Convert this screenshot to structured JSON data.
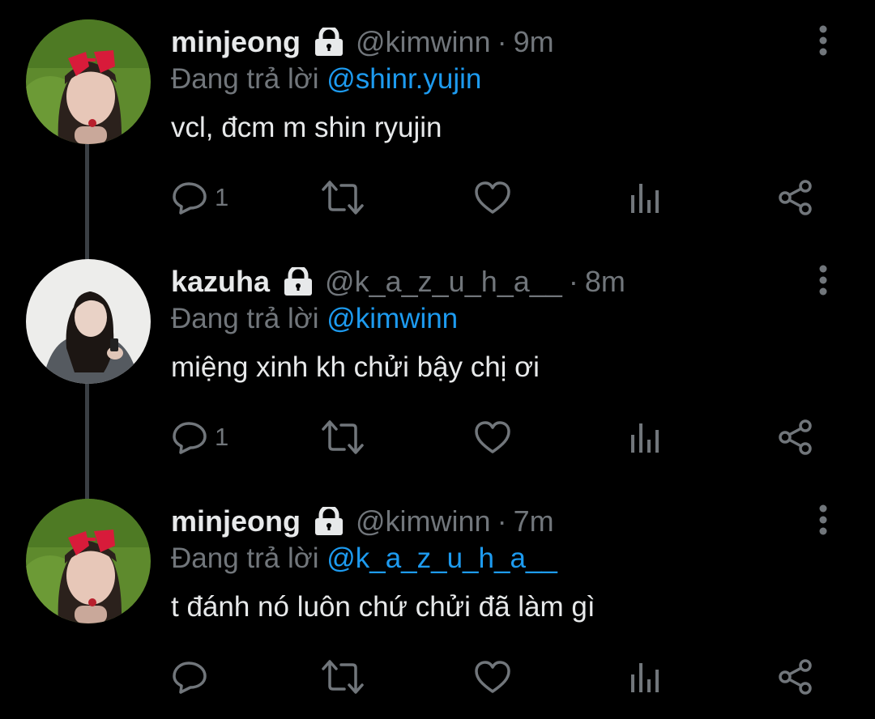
{
  "tweets": [
    {
      "name": "minjeong",
      "handle": "@kimwinn",
      "separator": "·",
      "time": "9m",
      "reply_prefix": "Đang trả lời",
      "reply_to": "@shinr.yujin",
      "text": "vcl, đcm m shin ryujin",
      "reply_count": "1",
      "avatar": "minjeong-avatar"
    },
    {
      "name": "kazuha",
      "handle": "@k_a_z_u_h_a__",
      "separator": "·",
      "time": "8m",
      "reply_prefix": "Đang trả lời",
      "reply_to": "@kimwinn",
      "text": "miệng xinh kh chửi bậy chị ơi",
      "reply_count": "1",
      "avatar": "kazuha-avatar"
    },
    {
      "name": "minjeong",
      "handle": "@kimwinn",
      "separator": "·",
      "time": "7m",
      "reply_prefix": "Đang trả lời",
      "reply_to": "@k_a_z_u_h_a__",
      "text": "t đánh nó luôn chứ chửi đã làm gì",
      "reply_count": "",
      "avatar": "minjeong-avatar"
    }
  ],
  "icons": {
    "lock": "lock-icon",
    "more": "more-vertical-icon",
    "reply": "reply-icon",
    "retweet": "retweet-icon",
    "like": "heart-icon",
    "views": "views-icon",
    "share": "share-icon"
  },
  "colors": {
    "background": "#000000",
    "text": "#e7e9ea",
    "muted": "#71767b",
    "link": "#1d9bf0",
    "thread_line": "#3a3f44"
  }
}
